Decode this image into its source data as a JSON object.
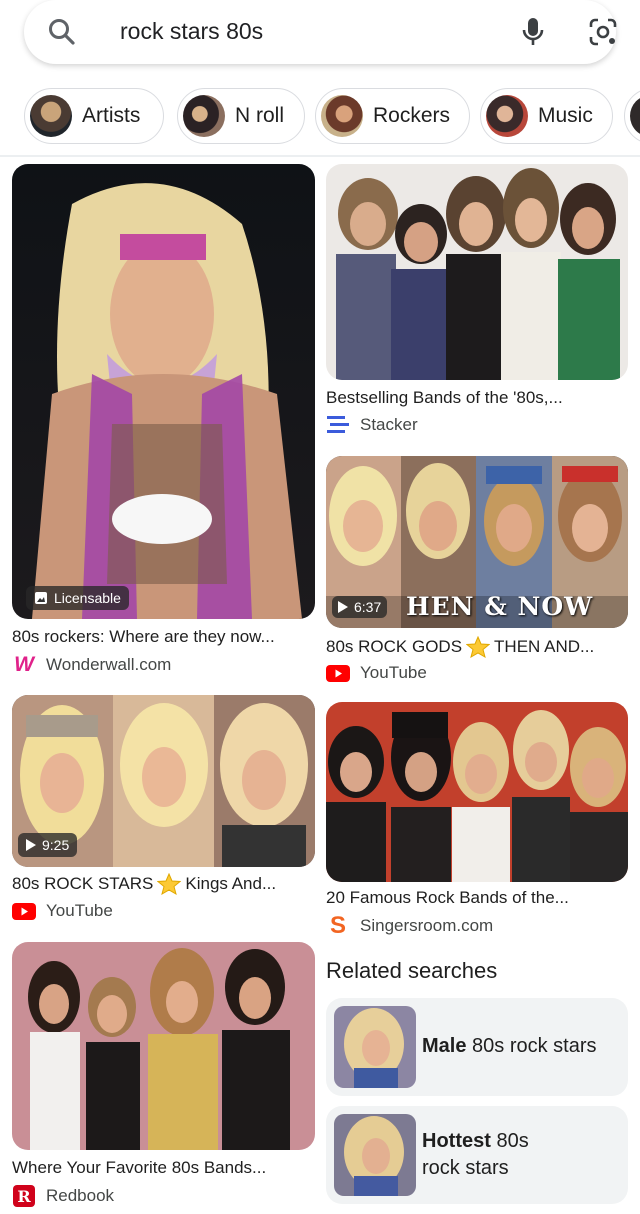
{
  "search": {
    "query": "rock stars 80s",
    "icons": {
      "search": "search-icon",
      "mic": "microphone-icon",
      "lens": "google-lens-icon"
    }
  },
  "chips": [
    {
      "label": "Artists"
    },
    {
      "label": "N roll"
    },
    {
      "label": "Rockers"
    },
    {
      "label": "Music"
    }
  ],
  "results": {
    "r1": {
      "title": "80s rockers: Where are they now...",
      "source": "Wonderwall.com",
      "badge": "Licensable"
    },
    "r2": {
      "title": "Bestselling Bands of the '80s,...",
      "source": "Stacker"
    },
    "r3": {
      "title_a": "80s ROCK GODS",
      "title_b": "THEN AND...",
      "source": "YouTube",
      "duration": "6:37",
      "overlay_text": "HEN & NOW"
    },
    "r4": {
      "title_a": "80s ROCK STARS",
      "title_b": "Kings And...",
      "source": "YouTube",
      "duration": "9:25"
    },
    "r5": {
      "title": "20 Famous Rock Bands of the...",
      "source": "Singersroom.com"
    },
    "r6": {
      "title": "Where Your Favorite 80s Bands...",
      "source": "Redbook"
    }
  },
  "related": {
    "heading": "Related searches",
    "items": [
      {
        "bold": "Male",
        "rest": "80s rock stars"
      },
      {
        "bold": "Hottest",
        "rest_1": "80s",
        "rest_2": "rock stars"
      }
    ]
  },
  "colors": {
    "wonderwall": "#e0218a",
    "youtube": "#ff0000",
    "stacker": "#3b5bdb",
    "singersroom": "#f26522",
    "redbook": "#d0021b"
  }
}
